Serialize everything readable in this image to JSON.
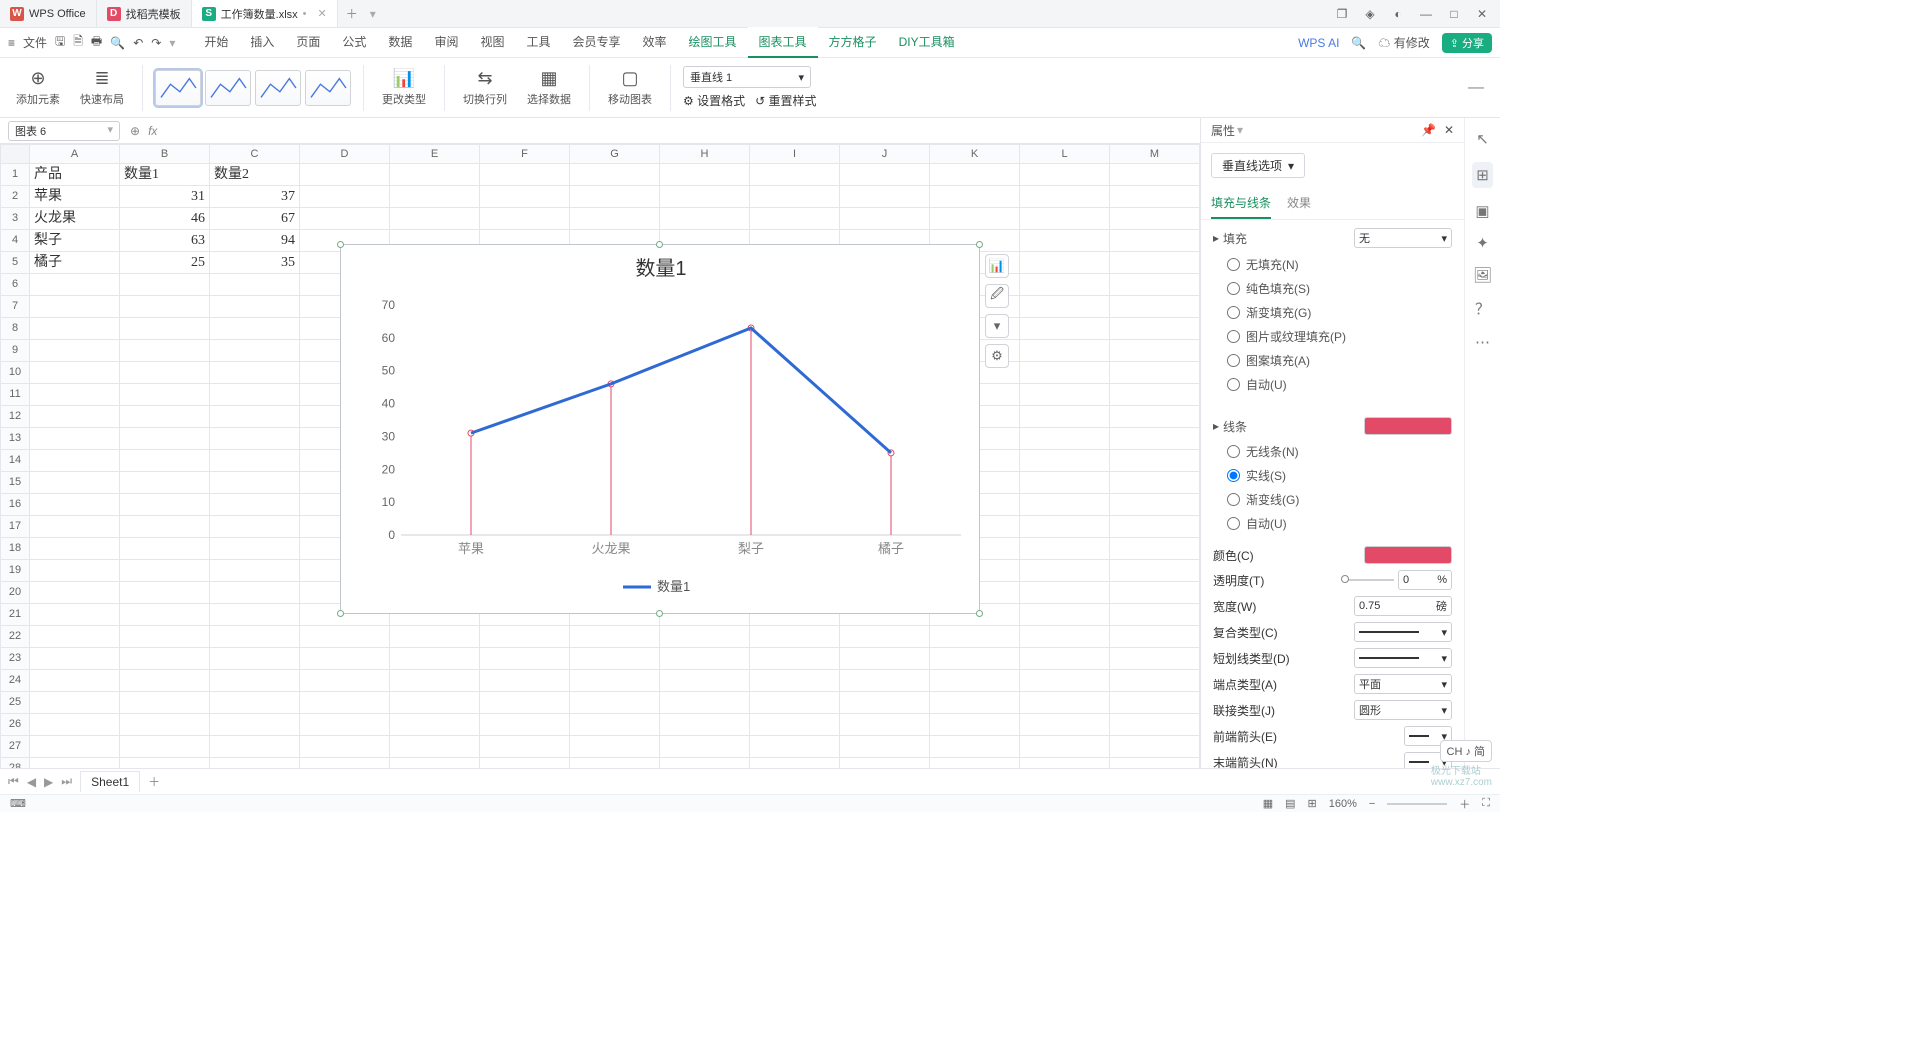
{
  "app_tabs": [
    {
      "icon": "W",
      "color": "#d8554a",
      "label": "WPS Office"
    },
    {
      "icon": "D",
      "color": "#e24a68",
      "label": "找稻壳模板"
    },
    {
      "icon": "S",
      "color": "#1aad81",
      "label": "工作簿数量.xlsx",
      "active": true,
      "dirty": "•"
    }
  ],
  "quick": {
    "menu": "≡",
    "file": "文件"
  },
  "menu_tabs": [
    "开始",
    "插入",
    "页面",
    "公式",
    "数据",
    "审阅",
    "视图",
    "工具",
    "会员专享",
    "效率"
  ],
  "context_tabs": [
    "绘图工具",
    "图表工具",
    "方方格子",
    "DIY工具箱"
  ],
  "active_menu": "图表工具",
  "menu_right": {
    "ai": "WPS AI",
    "mod": "有修改",
    "share": "分享"
  },
  "ribbon": {
    "add_element": "添加元素",
    "quick_layout": "快速布局",
    "change_type": "更改类型",
    "switch_rc": "切换行列",
    "select_data": "选择数据",
    "move_chart": "移动图表",
    "set_format": "设置格式",
    "reset_style": "重置样式",
    "series_combo": "垂直线 1"
  },
  "namebox": "图表 6",
  "columns": [
    "A",
    "B",
    "C",
    "D",
    "E",
    "F",
    "G",
    "H",
    "I",
    "J",
    "K",
    "L",
    "M"
  ],
  "row_count": 28,
  "table": {
    "headers": [
      "产品",
      "数量1",
      "数量2"
    ],
    "rows": [
      [
        "苹果",
        "31",
        "37"
      ],
      [
        "火龙果",
        "46",
        "67"
      ],
      [
        "梨子",
        "63",
        "94"
      ],
      [
        "橘子",
        "25",
        "35"
      ]
    ]
  },
  "chart_data": {
    "type": "line",
    "title": "数量1",
    "categories": [
      "苹果",
      "火龙果",
      "梨子",
      "橘子"
    ],
    "series": [
      {
        "name": "数量1",
        "values": [
          31,
          46,
          63,
          25
        ]
      }
    ],
    "ylim": [
      0,
      70
    ],
    "ystep": 10,
    "legend": "数量1",
    "drop_lines": true
  },
  "side_icons": [
    "chart-icon",
    "brush-icon",
    "filter-icon",
    "gear-icon"
  ],
  "panel": {
    "title": "属性",
    "dropdown": "垂直线选项",
    "tabs": [
      "填充与线条",
      "效果"
    ],
    "fill_label": "填充",
    "fill_combo": "无",
    "fill_options": [
      "无填充(N)",
      "纯色填充(S)",
      "渐变填充(G)",
      "图片或纹理填充(P)",
      "图案填充(A)",
      "自动(U)"
    ],
    "line_label": "线条",
    "line_options": [
      "无线条(N)",
      "实线(S)",
      "渐变线(G)",
      "自动(U)"
    ],
    "line_selected": "实线(S)",
    "props": {
      "color": "颜色(C)",
      "transparency": "透明度(T)",
      "transparency_val": "0",
      "transparency_unit": "%",
      "width": "宽度(W)",
      "width_val": "0.75",
      "width_unit": "磅",
      "compound": "复合类型(C)",
      "dash": "短划线类型(D)",
      "cap": "端点类型(A)",
      "cap_val": "平面",
      "join": "联接类型(J)",
      "join_val": "圆形",
      "arrow1": "前端箭头(E)",
      "arrow2": "末端箭头(N)"
    }
  },
  "sheet_tab": "Sheet1",
  "status": {
    "zoom": "160%"
  },
  "ime": "CH ♪ 简",
  "watermark1": "极光下载站",
  "watermark2": "www.xz7.com"
}
